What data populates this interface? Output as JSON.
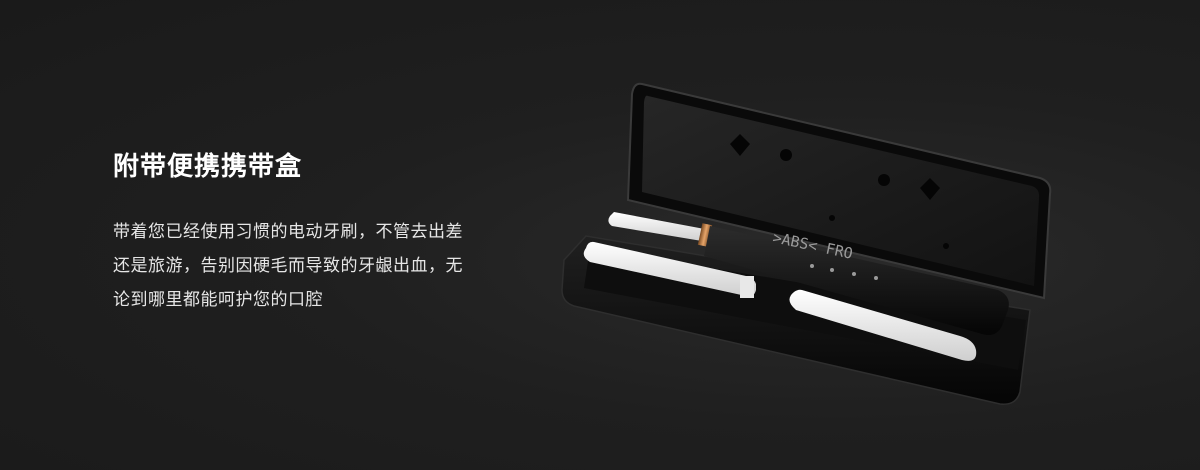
{
  "headline": "附带便携携带盒",
  "description_lines": [
    "带着您已经使用习惯的电动牙刷，不管去出差",
    "还是旅游，告别因硬毛而导致的牙龈出血，无",
    "论到哪里都能呵护您的口腔"
  ],
  "product_markings": {
    "mode_display": ">ABS< FRO"
  },
  "colors": {
    "background": "#1e1e1e",
    "headline": "#ffffff",
    "body_text": "#e6e6e6",
    "case_black": "#0c0c0c",
    "brush_white": "#f2f2f2",
    "copper_ring": "#b7773f"
  }
}
